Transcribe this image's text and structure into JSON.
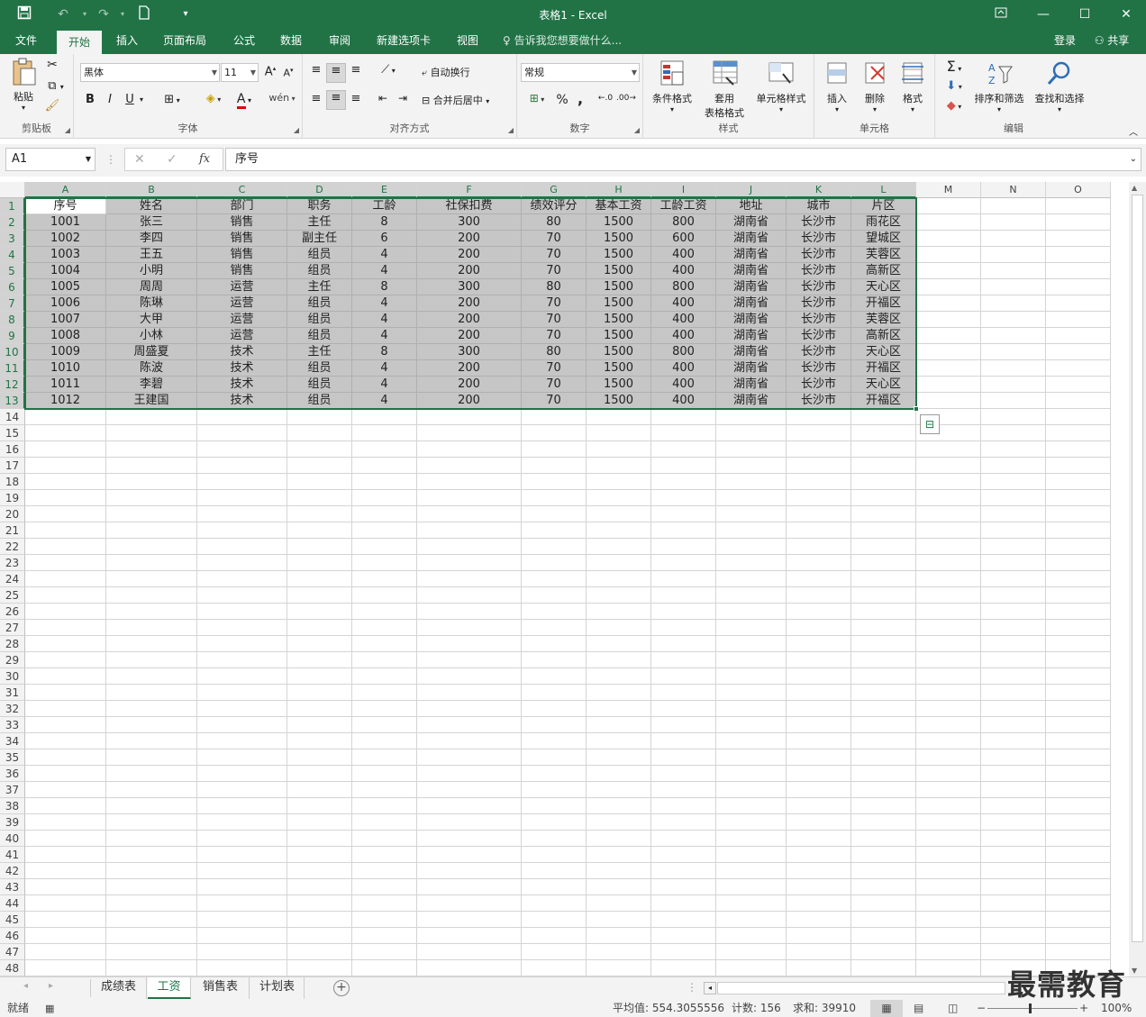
{
  "window": {
    "title": "表格1 - Excel"
  },
  "menu_tabs": [
    "文件",
    "开始",
    "插入",
    "页面布局",
    "公式",
    "数据",
    "审阅",
    "新建选项卡",
    "视图"
  ],
  "active_tab": "开始",
  "tell_me": "告诉我您想要做什么...",
  "account": {
    "login": "登录",
    "share": "共享"
  },
  "ribbon": {
    "clipboard": {
      "label": "剪贴板",
      "paste": "粘贴"
    },
    "font": {
      "label": "字体",
      "font_name": "黑体",
      "font_size": "11",
      "bold": "B",
      "italic": "I",
      "underline": "U"
    },
    "align": {
      "label": "对齐方式",
      "wrap": "自动换行",
      "merge": "合并后居中"
    },
    "number": {
      "label": "数字",
      "format": "常规",
      "percent": "%",
      "comma": ","
    },
    "styles": {
      "label": "样式",
      "cond": "条件格式",
      "table1": "套用",
      "table2": "表格格式",
      "cell_style": "单元格样式"
    },
    "cells": {
      "label": "单元格",
      "insert": "插入",
      "delete": "删除",
      "format": "格式"
    },
    "editing": {
      "label": "编辑",
      "sort": "排序和筛选",
      "find": "查找和选择"
    }
  },
  "formula_bar": {
    "name_box": "A1",
    "fx": "fx",
    "content": "序号"
  },
  "columns": [
    "A",
    "B",
    "C",
    "D",
    "E",
    "F",
    "G",
    "H",
    "I",
    "J",
    "K",
    "L",
    "M",
    "N",
    "O"
  ],
  "sheet": {
    "headers": [
      "序号",
      "姓名",
      "部门",
      "职务",
      "工龄",
      "社保扣费",
      "绩效评分",
      "基本工资",
      "工龄工资",
      "地址",
      "城市",
      "片区"
    ],
    "rows": [
      [
        "1001",
        "张三",
        "销售",
        "主任",
        "8",
        "300",
        "80",
        "1500",
        "800",
        "湖南省",
        "长沙市",
        "雨花区"
      ],
      [
        "1002",
        "李四",
        "销售",
        "副主任",
        "6",
        "200",
        "70",
        "1500",
        "600",
        "湖南省",
        "长沙市",
        "望城区"
      ],
      [
        "1003",
        "王五",
        "销售",
        "组员",
        "4",
        "200",
        "70",
        "1500",
        "400",
        "湖南省",
        "长沙市",
        "芙蓉区"
      ],
      [
        "1004",
        "小明",
        "销售",
        "组员",
        "4",
        "200",
        "70",
        "1500",
        "400",
        "湖南省",
        "长沙市",
        "高新区"
      ],
      [
        "1005",
        "周周",
        "运营",
        "主任",
        "8",
        "300",
        "80",
        "1500",
        "800",
        "湖南省",
        "长沙市",
        "天心区"
      ],
      [
        "1006",
        "陈琳",
        "运营",
        "组员",
        "4",
        "200",
        "70",
        "1500",
        "400",
        "湖南省",
        "长沙市",
        "开福区"
      ],
      [
        "1007",
        "大甲",
        "运营",
        "组员",
        "4",
        "200",
        "70",
        "1500",
        "400",
        "湖南省",
        "长沙市",
        "芙蓉区"
      ],
      [
        "1008",
        "小林",
        "运营",
        "组员",
        "4",
        "200",
        "70",
        "1500",
        "400",
        "湖南省",
        "长沙市",
        "高新区"
      ],
      [
        "1009",
        "周盛夏",
        "技术",
        "主任",
        "8",
        "300",
        "80",
        "1500",
        "800",
        "湖南省",
        "长沙市",
        "天心区"
      ],
      [
        "1010",
        "陈波",
        "技术",
        "组员",
        "4",
        "200",
        "70",
        "1500",
        "400",
        "湖南省",
        "长沙市",
        "开福区"
      ],
      [
        "1011",
        "李碧",
        "技术",
        "组员",
        "4",
        "200",
        "70",
        "1500",
        "400",
        "湖南省",
        "长沙市",
        "天心区"
      ],
      [
        "1012",
        "王建国",
        "技术",
        "组员",
        "4",
        "200",
        "70",
        "1500",
        "400",
        "湖南省",
        "长沙市",
        "开福区"
      ]
    ],
    "row_count": 48
  },
  "sheet_tabs": [
    "成绩表",
    "工资",
    "销售表",
    "计划表"
  ],
  "active_sheet": "工资",
  "status": {
    "ready": "就绪",
    "average": "平均值: 554.3055556",
    "count": "计数: 156",
    "sum": "求和: 39910",
    "zoom": "100%"
  },
  "watermark": "最需教育",
  "colors": {
    "brand": "#217346",
    "selection": "#c6c6c6"
  }
}
